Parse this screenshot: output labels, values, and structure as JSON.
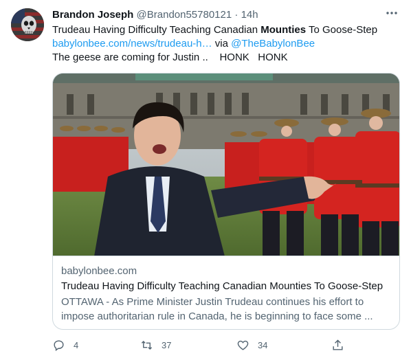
{
  "tweet": {
    "author": {
      "name": "Brandon Joseph",
      "handle": "@Brandon55780121",
      "avatar_icon": "flag-skull-avatar"
    },
    "separator": "·",
    "time": "14h",
    "more_icon": "more-horizontal-icon",
    "text": {
      "line1_prefix": "Trudeau Having Difficulty Teaching Canadian ",
      "line1_bold": "Mounties",
      "line1_suffix": " To Goose-Step",
      "link_url": "babylonbee.com/news/trudeau-h…",
      "via": " via ",
      "mention": "@TheBabylonBee",
      "line3": "The geese are coming for Justin ..    HONK   HONK"
    },
    "card": {
      "image_alt": "photo",
      "domain": "babylonbee.com",
      "title": "Trudeau Having Difficulty Teaching Canadian Mounties To Goose-Step",
      "description": "OTTAWA - As Prime Minister Justin Trudeau continues his effort to impose authoritarian rule in Canada, he is beginning to face some ..."
    },
    "actions": {
      "reply": {
        "icon": "reply-icon",
        "count": "4"
      },
      "retweet": {
        "icon": "retweet-icon",
        "count": "37"
      },
      "like": {
        "icon": "heart-icon",
        "count": "34"
      },
      "share": {
        "icon": "share-icon"
      }
    },
    "colors": {
      "link": "#1d9bf0",
      "secondary_text": "#536471",
      "border": "#cfd9de",
      "mountie_red": "#c8201e"
    }
  }
}
